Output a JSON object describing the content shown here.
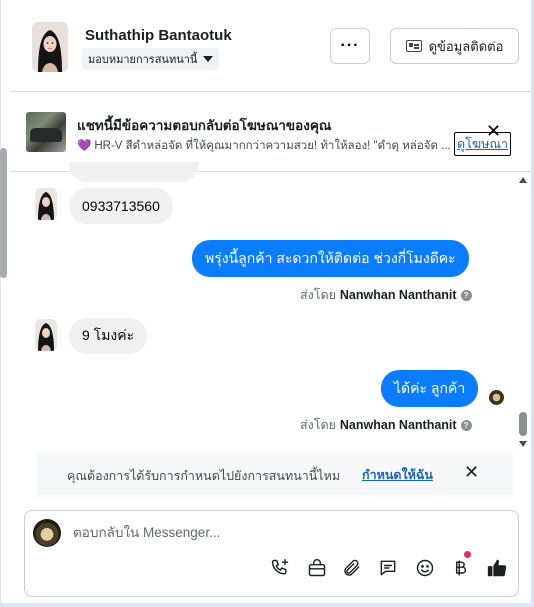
{
  "header": {
    "contact_name": "Suthathip Bantaotuk",
    "assign_label": "มอบหมายการสนทนานี้",
    "more_label": "···",
    "contact_info_label": "ดูข้อมูลติดต่อ"
  },
  "ad_banner": {
    "title": "แชทนี้มีข้อความตอบกลับต่อโฆษณาของคุณ",
    "heart": "💜",
    "description": "HR-V สีดำหล่อจัด ที่ให้คุณมากกว่าความสวย! ท้าให้ลอง! \"ดำดุ หล่อจัด ...",
    "link_label": "ดูโฆษณา",
    "close_label": "✕"
  },
  "messages": [
    {
      "direction": "in",
      "text": "0933713560"
    },
    {
      "direction": "out",
      "text": "พรุ่งนี้ลูกค้า สะดวกให้ติดต่อ ช่วงกี่โมงดีคะ",
      "sent_by_prefix": "ส่งโดย",
      "sent_by_name": "Nanwhan Nanthanit"
    },
    {
      "direction": "in",
      "text": "9 โมงค่ะ"
    },
    {
      "direction": "out",
      "text": "ได้ค่ะ  ลูกค้า",
      "sent_by_prefix": "ส่งโดย",
      "sent_by_name": "Nanwhan Nanthanit"
    }
  ],
  "help_mark": "?",
  "followup": {
    "text": "คุณต้องการได้รับการกำหนดไปยังการสนทนานี้ไหม",
    "link_label": "กำหนดให้ฉัน",
    "close_label": "✕"
  },
  "composer": {
    "placeholder": "ตอบกลับใน Messenger...",
    "tools": [
      "phone-add-icon",
      "shopping-bag-icon",
      "paperclip-icon",
      "chat-bubble-icon",
      "emoji-icon",
      "baht-icon",
      "thumbs-up-icon"
    ]
  },
  "colors": {
    "outgoing_bubble": "#0a7cff",
    "incoming_bubble": "#f0f0f0",
    "link": "#1762c4"
  }
}
